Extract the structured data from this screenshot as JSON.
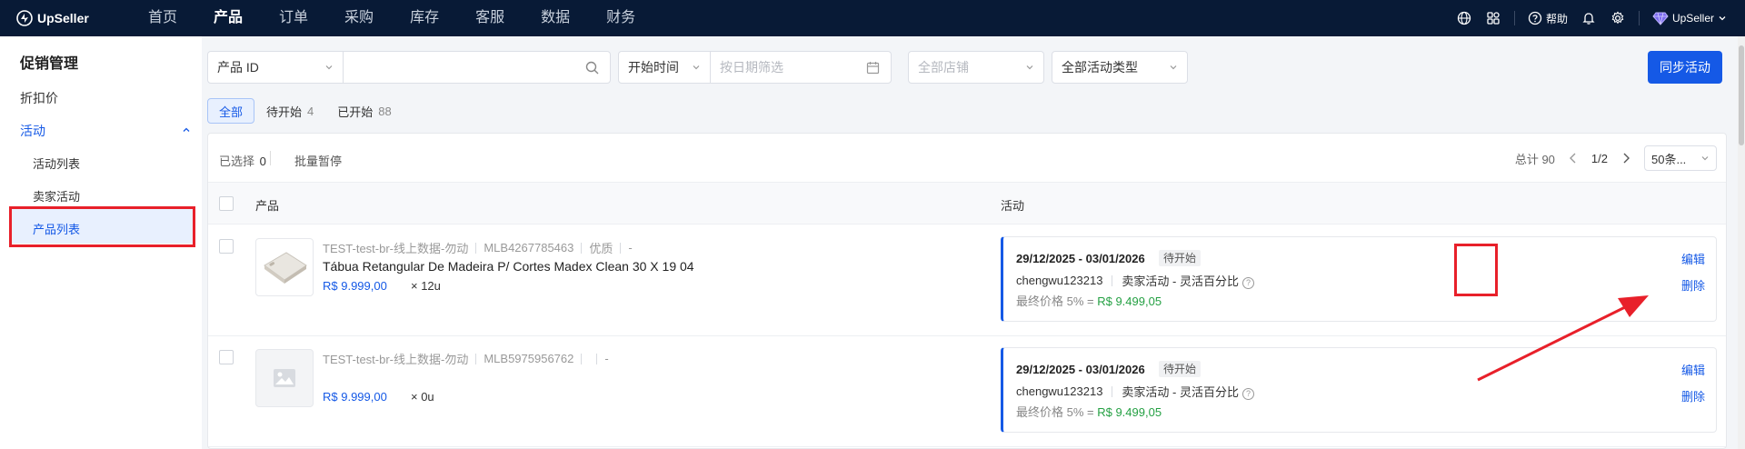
{
  "brand": {
    "name": "UpSeller"
  },
  "nav": {
    "items": [
      "首页",
      "产品",
      "订单",
      "采购",
      "库存",
      "客服",
      "数据",
      "财务"
    ],
    "active_index": 1,
    "help_label": "帮助",
    "user_label": "UpSeller",
    "icons": [
      "globe-icon",
      "grid-icon",
      "help-icon",
      "bell-icon",
      "gear-icon",
      "gem-icon"
    ]
  },
  "sidebar": {
    "title": "促销管理",
    "discount": "折扣价",
    "activity_group": "活动",
    "subs": [
      "活动列表",
      "卖家活动",
      "产品列表"
    ],
    "active_sub_index": 2
  },
  "filters": {
    "product_id_select": "产品 ID",
    "search_placeholder": "",
    "time_select": "开始时间",
    "date_placeholder": "按日期筛选",
    "store_placeholder": "全部店铺",
    "type_select": "全部活动类型",
    "sync_button": "同步活动"
  },
  "tabs": [
    {
      "label": "全部",
      "count": ""
    },
    {
      "label": "待开始",
      "count": "4"
    },
    {
      "label": "已开始",
      "count": "88"
    }
  ],
  "toolbar": {
    "selected_label": "已选择",
    "selected_count": "0",
    "batch_pause": "批量暂停",
    "total_label": "总计 90",
    "page": "1/2",
    "page_size": "50条..."
  },
  "table": {
    "headers": {
      "product": "产品",
      "activity": "活动"
    },
    "rows": [
      {
        "meta_id": "TEST-test-br-线上数据-勿动",
        "mlb": "MLB4267785463",
        "quality": "优质",
        "extra": "-",
        "title": "Tábua Retangular De Madeira P/ Cortes Madex Clean 30 X 19 04",
        "price": "R$ 9.999,00",
        "qty": "× 12u",
        "has_image": true,
        "activity": {
          "date": "29/12/2025 - 03/01/2026",
          "status": "待开始",
          "account": "chengwu123213",
          "type": "卖家活动 - 灵活百分比",
          "final_label": "最终价格 5% = ",
          "final_price": "R$ 9.499,05"
        },
        "ops": {
          "edit": "编辑",
          "delete": "删除"
        }
      },
      {
        "meta_id": "TEST-test-br-线上数据-勿动",
        "mlb": "MLB5975956762",
        "quality": "",
        "extra": "-",
        "title": "",
        "price": "R$ 9.999,00",
        "qty": "× 0u",
        "has_image": false,
        "activity": {
          "date": "29/12/2025 - 03/01/2026",
          "status": "待开始",
          "account": "chengwu123213",
          "type": "卖家活动 - 灵活百分比",
          "final_label": "最终价格 5% = ",
          "final_price": "R$ 9.499,05"
        },
        "ops": {
          "edit": "编辑",
          "delete": "删除"
        }
      }
    ]
  },
  "colors": {
    "nav_bg": "#081a36",
    "accent": "#1559e6",
    "highlight_red": "#e8202a",
    "final_price_green": "#24a043"
  }
}
